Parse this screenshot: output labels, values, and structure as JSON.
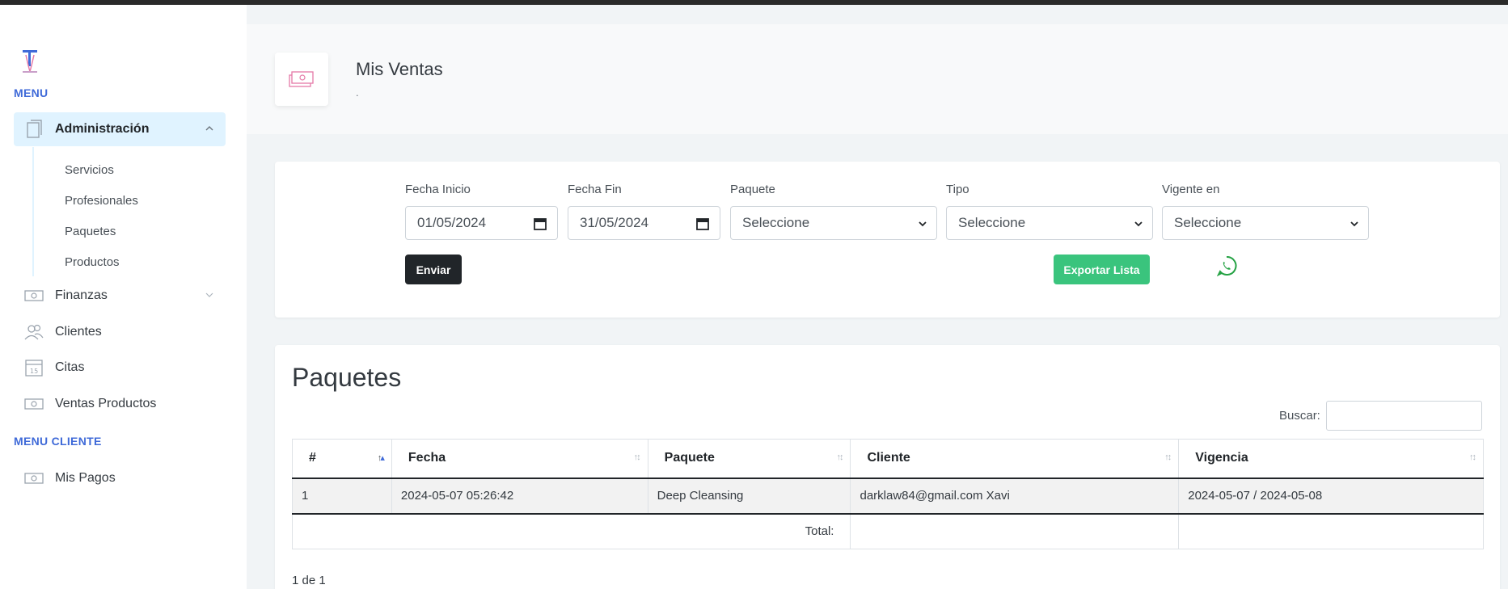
{
  "sidebar": {
    "menu_heading": "MENU",
    "items": [
      {
        "label": "Administración",
        "icon": "document-icon",
        "active": true
      },
      {
        "label": "Finanzas",
        "icon": "money-icon"
      },
      {
        "label": "Clientes",
        "icon": "users-icon"
      },
      {
        "label": "Citas",
        "icon": "calendar-icon"
      },
      {
        "label": "Ventas Productos",
        "icon": "money-icon"
      }
    ],
    "subitems": [
      "Servicios",
      "Profesionales",
      "Paquetes",
      "Productos"
    ],
    "client_heading": "MENU CLIENTE",
    "client_items": [
      {
        "label": "Mis Pagos",
        "icon": "money-icon"
      }
    ]
  },
  "header": {
    "title": "Mis Ventas",
    "subtitle": "."
  },
  "filters": {
    "fecha_inicio_label": "Fecha Inicio",
    "fecha_inicio_value": "01/05/2024",
    "fecha_fin_label": "Fecha Fin",
    "fecha_fin_value": "31/05/2024",
    "paquete_label": "Paquete",
    "paquete_value": "Seleccione",
    "tipo_label": "Tipo",
    "tipo_value": "Seleccione",
    "vigente_label": "Vigente en",
    "vigente_value": "Seleccione",
    "submit_label": "Enviar",
    "export_label": "Exportar Lista"
  },
  "table": {
    "title": "Paquetes",
    "search_label": "Buscar:",
    "columns": [
      "#",
      "Fecha",
      "Paquete",
      "Cliente",
      "Vigencia"
    ],
    "rows": [
      [
        "1",
        "2024-05-07 05:26:42",
        "Deep Cleansing",
        "darklaw84@gmail.com Xavi",
        "2024-05-07 / 2024-05-08"
      ]
    ],
    "total_label": "Total:",
    "pagination": "1 de 1"
  },
  "colors": {
    "accent": "#3f6ad8",
    "active_bg": "#e0f3ff",
    "export": "#3ac47d",
    "whatsapp": "#25a244"
  }
}
